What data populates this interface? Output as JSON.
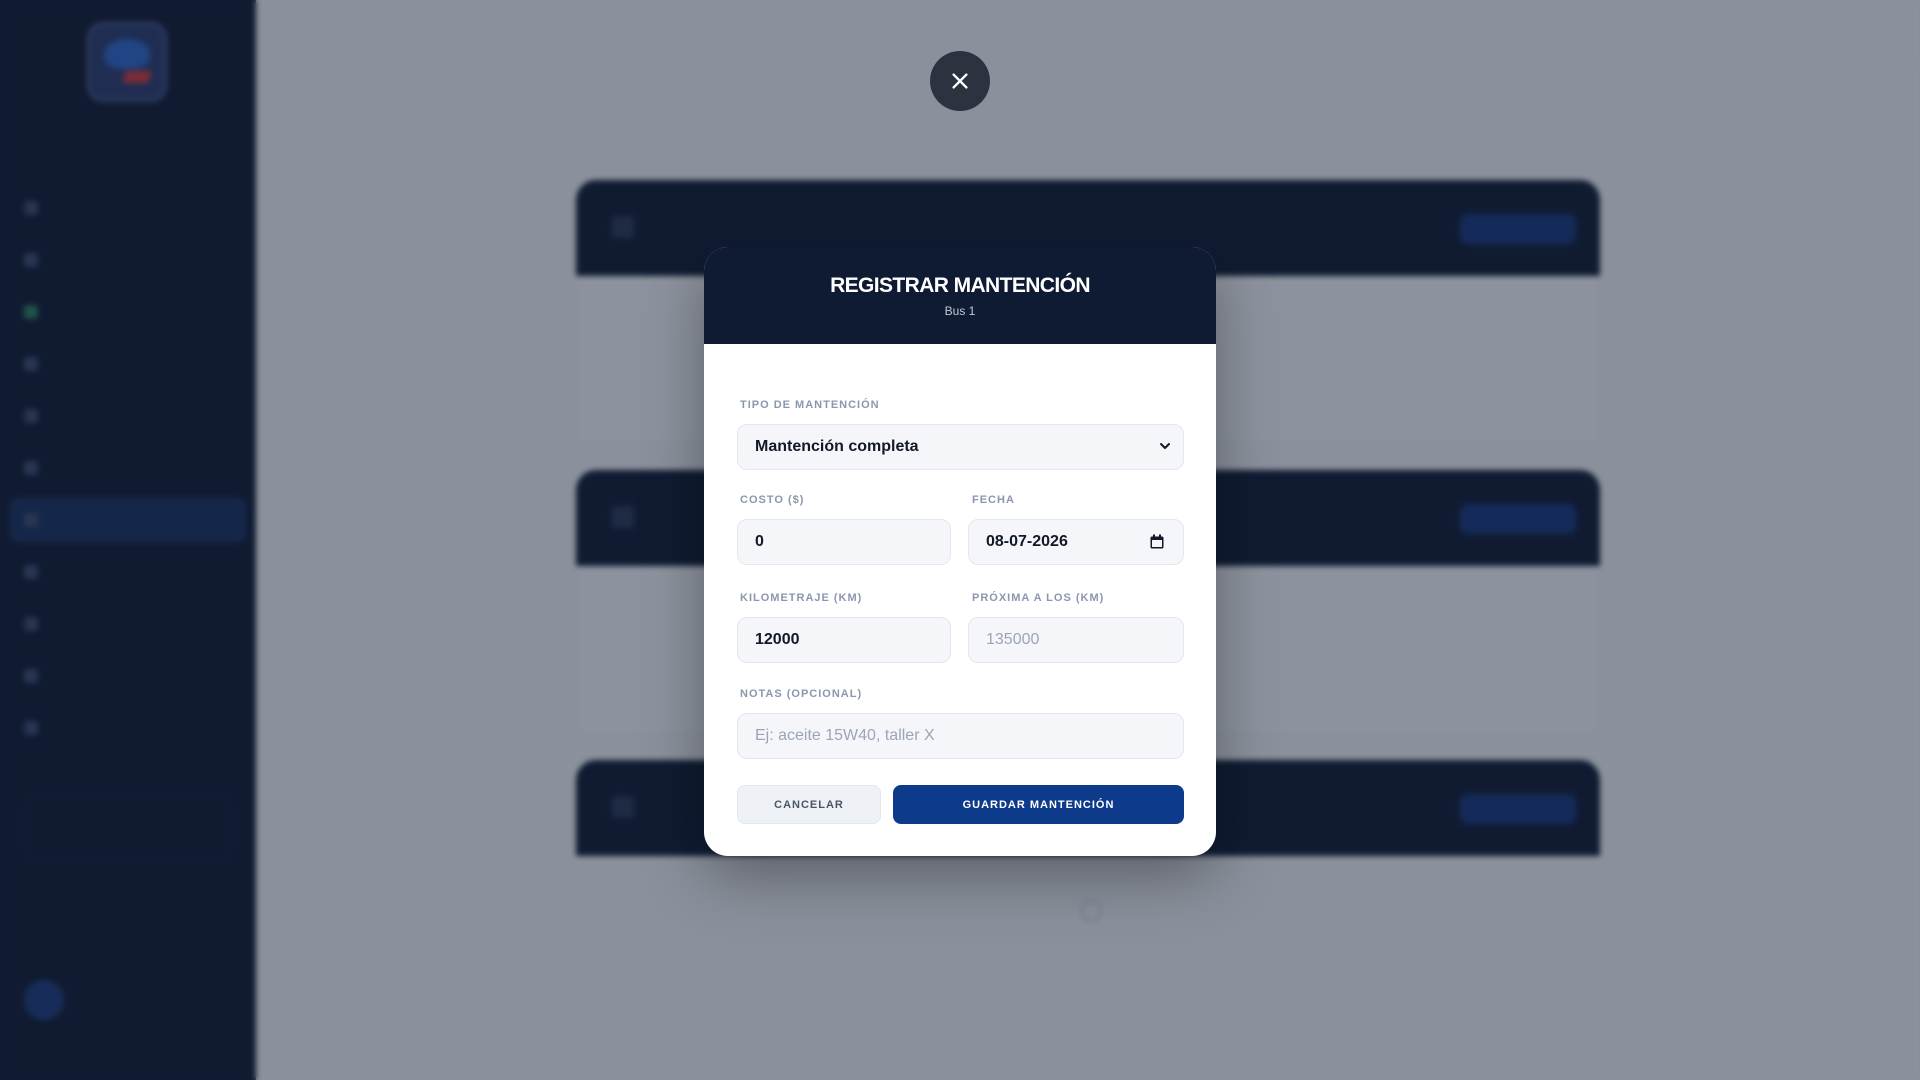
{
  "modal": {
    "title": "REGISTRAR MANTENCIÓN",
    "subtitle": "Bus 1",
    "fields": {
      "tipo": {
        "label": "TIPO DE MANTENCIÓN",
        "value": "Mantención completa"
      },
      "costo": {
        "label": "COSTO ($)",
        "value": "0"
      },
      "fecha": {
        "label": "FECHA",
        "value": "08-07-2026"
      },
      "kilometraje": {
        "label": "KILOMETRAJE (KM)",
        "value": "12000"
      },
      "proxima": {
        "label": "PRÓXIMA A LOS (KM)",
        "placeholder": "135000"
      },
      "notas": {
        "label": "NOTAS (OPCIONAL)",
        "placeholder": "Ej: aceite 15W40, taller X"
      }
    },
    "buttons": {
      "cancel": "CANCELAR",
      "save": "GUARDAR MANTENCIÓN"
    }
  },
  "icons": {
    "close": "close-icon",
    "select": "chevron-down-icon",
    "calendar": "calendar-icon"
  },
  "colors": {
    "header_bg": "#0f1a33",
    "primary": "#0d3a8a",
    "overlay": "#121c30"
  }
}
